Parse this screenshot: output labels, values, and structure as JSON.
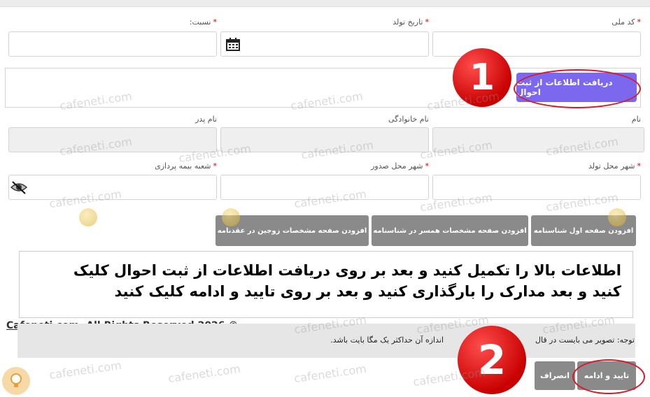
{
  "form": {
    "national_code_label": "کد ملی",
    "birth_date_label": "تاریخ تولد",
    "relation_label": "نسبت:",
    "fetch_button": "دریافت اطلاعات از ثبت احوال",
    "first_name_label": "نام",
    "last_name_label": "نام خانوادگی",
    "father_name_label": "نام پدر",
    "birth_city_label": "شهر محل تولد",
    "issue_city_label": "شهر محل صدور",
    "insurance_branch_label": "شعبه بیمه پردازی",
    "required_mark": "*"
  },
  "doc_buttons": [
    "افزودن صفحه اول شناسنامه",
    "افزودن صفحه مشخصات همسر در شناسنامه",
    "افزودن صفحه مشخصات زوجین در عقدنامه"
  ],
  "instruction": {
    "line1": "اطلاعات بالا را تکمیل کنید و بعد بر روی دریافت اطلاعات از ثبت احوال کلیک",
    "line2": "کنید و بعد مدارک را بارگذاری کنید و بعد بر روی تایید و ادامه کلیک کنید"
  },
  "copyright": "Cafeneti.com. All Rights Reserved 2026 ©",
  "note": {
    "left_part": "توجه: تصویر می بایست در قال",
    "right_part": "اندازه آن حداکثر یک مگا بایت باشد."
  },
  "actions": {
    "confirm": "تایید و ادامه",
    "cancel": "انصراف"
  },
  "badges": {
    "one": "1",
    "two": "2"
  },
  "watermark": "cafeneti.com",
  "colors": {
    "accent": "#7b68ee",
    "badge": "#e00000",
    "button_gray": "#8a8a8a"
  }
}
